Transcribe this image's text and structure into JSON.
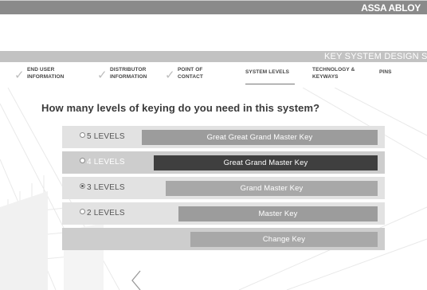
{
  "brand": {
    "name": "ASSA ABLOY"
  },
  "header": {
    "title": "KEY SYSTEM DESIGN S"
  },
  "steps": [
    {
      "label": "END USER INFORMATION",
      "completed": true
    },
    {
      "label": "DISTRIBUTOR INFORMATION",
      "completed": true
    },
    {
      "label": "POINT OF CONTACT",
      "completed": true
    },
    {
      "label": "SYSTEM LEVELS",
      "active": true
    },
    {
      "label": "TECHNOLOGY & KEYWAYS"
    },
    {
      "label": "PINS"
    }
  ],
  "question": "How many levels of keying do you need in this system?",
  "levels": [
    {
      "label": "5 LEVELS",
      "key": "Great Great Grand Master Key",
      "selected": false
    },
    {
      "label": "4 LEVELS",
      "key": "Great Grand Master Key",
      "selected": false
    },
    {
      "label": "3 LEVELS",
      "key": "Grand Master Key",
      "selected": true
    },
    {
      "label": "2 LEVELS",
      "key": "Master Key",
      "selected": false
    },
    {
      "label": "",
      "key": "Change Key",
      "selected": false
    }
  ],
  "colors": {
    "topbar": "#8a8a8a",
    "titlebar": "#c2c2c2",
    "row_light": "#e2e2e2",
    "row_mid": "#cdcdcd",
    "key_bar": "#9c9c9c",
    "key_bar_highlight": "#3f3f3f"
  },
  "icons": {
    "back": "chevron-left-icon",
    "check": "check-icon"
  }
}
